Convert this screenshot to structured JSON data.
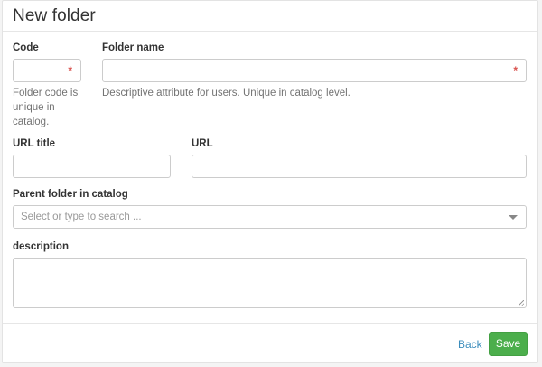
{
  "header": {
    "title": "New folder"
  },
  "form": {
    "code": {
      "label": "Code",
      "value": "",
      "required_mark": "*",
      "help_lines": [
        "Folder code is",
        "unique in",
        "catalog."
      ]
    },
    "folder_name": {
      "label": "Folder name",
      "value": "",
      "required_mark": "*",
      "help": "Descriptive attribute for users. Unique in catalog level."
    },
    "url_title": {
      "label": "URL title",
      "value": ""
    },
    "url": {
      "label": "URL",
      "value": ""
    },
    "parent_folder": {
      "label": "Parent folder in catalog",
      "placeholder": "Select or type to search ..."
    },
    "description": {
      "label": "description",
      "value": ""
    }
  },
  "footer": {
    "back_label": "Back",
    "save_label": "Save"
  },
  "colors": {
    "accent_link": "#3c8dbc",
    "save_button": "#4cae4c",
    "required": "#d9534f"
  }
}
